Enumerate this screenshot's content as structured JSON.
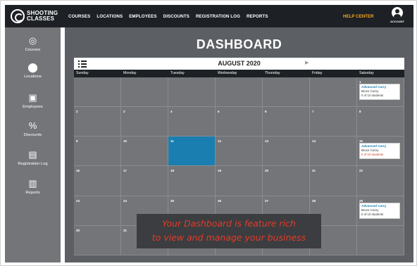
{
  "brand": {
    "logo_line1": "SHOOTING",
    "logo_line2": "CLASSES"
  },
  "nav": [
    "COURSES",
    "LOCATIONS",
    "EMPLOYEES",
    "DISCOUNTS",
    "REGISTRATION LOG",
    "REPORTS"
  ],
  "help_label": "HELP CENTER",
  "account_label": "ACCOUNT",
  "sidebar": [
    {
      "label": "Courses",
      "icon": "target-icon",
      "glyph": "◎"
    },
    {
      "label": "Locations",
      "icon": "map-pin-icon",
      "glyph": "⬤"
    },
    {
      "label": "Employees",
      "icon": "employees-icon",
      "glyph": "▣"
    },
    {
      "label": "Discounts",
      "icon": "discount-tag-icon",
      "glyph": "%"
    },
    {
      "label": "Registration Log",
      "icon": "document-icon",
      "glyph": "▤"
    },
    {
      "label": "Reports",
      "icon": "bar-chart-icon",
      "glyph": "▥"
    }
  ],
  "page_title": "DASHBOARD",
  "calendar": {
    "month": "AUGUST 2020",
    "days": [
      "Sunday",
      "Monday",
      "Tuesday",
      "Wednesday",
      "Thursday",
      "Friday",
      "Saturday"
    ],
    "weeks": [
      [
        "",
        "",
        "",
        "",
        "",
        "",
        "1"
      ],
      [
        "2",
        "3",
        "4",
        "5",
        "6",
        "7",
        "8"
      ],
      [
        "9",
        "10",
        "11",
        "12",
        "13",
        "14",
        "15"
      ],
      [
        "16",
        "17",
        "18",
        "19",
        "20",
        "21",
        "22"
      ],
      [
        "23",
        "24",
        "25",
        "26",
        "27",
        "28",
        "29"
      ],
      [
        "30",
        "31",
        "",
        "",
        "",
        "",
        ""
      ]
    ],
    "highlight_day": "11",
    "events": [
      {
        "day": "1",
        "title": "Advanced Carry",
        "instructor": "Bruce Corey",
        "enrollment": "0 of 10 students",
        "warn": false
      },
      {
        "day": "15",
        "title": "Advanced Carry",
        "instructor": "Bruce Corey",
        "enrollment": "0 of 10 students",
        "warn": true
      },
      {
        "day": "29",
        "title": "Advanced Carry",
        "instructor": "Bruce Corey",
        "enrollment": "0 of 10 students",
        "warn": false
      }
    ]
  },
  "overlay": {
    "line1": "Your Dashboard is feature rich",
    "line2": "to view and manage your business"
  },
  "colors": {
    "topbar": "#1d2024",
    "help": "#f5a623",
    "highlight": "#1a7fb0",
    "overlay_text": "#e23b2a"
  }
}
